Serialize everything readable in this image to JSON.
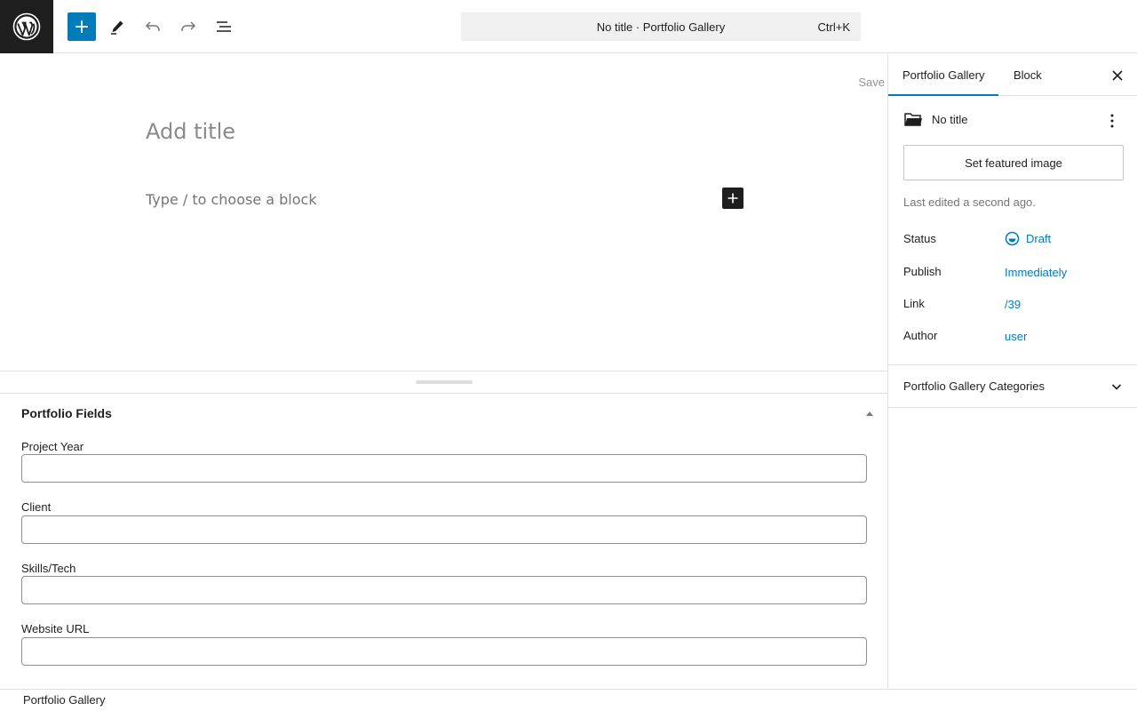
{
  "toolbar": {
    "logo_icon": "wordpress-logo-icon",
    "add_icon": "plus-icon",
    "edit_icon": "pencil-icon",
    "undo_icon": "undo-icon",
    "redo_icon": "redo-icon",
    "list_view_icon": "list-view-icon",
    "command_bar_text": "No title · Portfolio Gallery",
    "command_shortcut": "Ctrl+K"
  },
  "editor": {
    "save_label": "Save",
    "title_placeholder": "Add title",
    "block_placeholder": "Type / to choose a block",
    "inline_add_icon": "plus-icon"
  },
  "metabox": {
    "title": "Portfolio Fields",
    "toggle_icon": "triangle-up-icon",
    "fields": [
      {
        "label": "Project Year",
        "value": ""
      },
      {
        "label": "Client",
        "value": ""
      },
      {
        "label": "Skills/Tech",
        "value": ""
      },
      {
        "label": "Website URL",
        "value": ""
      }
    ]
  },
  "footer": {
    "breadcrumb": "Portfolio Gallery"
  },
  "sidebar": {
    "tabs": [
      {
        "label": "Portfolio Gallery",
        "active": true
      },
      {
        "label": "Block",
        "active": false
      }
    ],
    "close_icon": "close-icon",
    "post_card": {
      "icon": "folder-icon",
      "title": "No title",
      "more_icon": "more-vertical-icon"
    },
    "featured_image_label": "Set featured image",
    "last_edited": "Last edited a second ago.",
    "rows": [
      {
        "label": "Status",
        "value": "Draft"
      },
      {
        "label": "Publish",
        "value": "Immediately"
      },
      {
        "label": "Link",
        "value": "/39"
      },
      {
        "label": "Author",
        "value": "user"
      }
    ],
    "categories_panel": {
      "title": "Portfolio Gallery Categories",
      "chevron_icon": "chevron-down-icon"
    }
  },
  "colors": {
    "accent": "#007cba",
    "dark": "#1e1e1e",
    "border": "#e0e0e0"
  }
}
